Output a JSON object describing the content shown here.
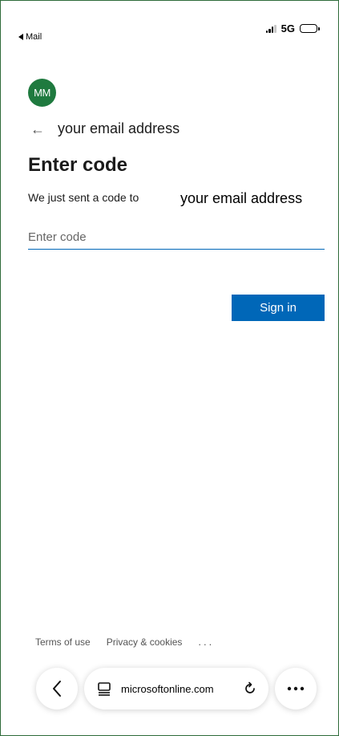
{
  "status_bar": {
    "back_app": "Mail",
    "network": "5G"
  },
  "account": {
    "avatar_initials": "MM",
    "identity": "your email address"
  },
  "form": {
    "title": "Enter code",
    "sent_text": "We just sent a code to",
    "sent_email": "your email address",
    "code_placeholder": "Enter code",
    "code_value": "",
    "submit_label": "Sign in"
  },
  "footer": {
    "terms": "Terms of use",
    "privacy": "Privacy & cookies",
    "more": "..."
  },
  "browser": {
    "url": "microsoftonline.com",
    "icons": [
      "back-icon",
      "tabs-icon",
      "reload-icon",
      "more-icon"
    ]
  },
  "colors": {
    "accent": "#0067b8",
    "avatar_bg": "#1f7a3f",
    "frame_border": "#2e6b3a"
  }
}
